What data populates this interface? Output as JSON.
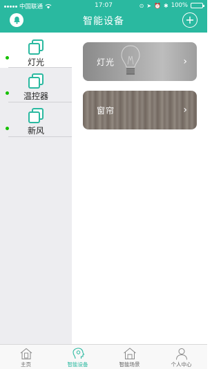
{
  "status_bar": {
    "carrier": "中国联通",
    "time": "17:07",
    "battery": "100%"
  },
  "header": {
    "title": "智能设备"
  },
  "sidebar": {
    "items": [
      {
        "label": "灯光"
      },
      {
        "label": "温控器"
      },
      {
        "label": "新风"
      }
    ]
  },
  "cards": [
    {
      "label": "灯光",
      "chevron": "›"
    },
    {
      "label": "窗帘",
      "chevron": "›"
    }
  ],
  "tabbar": {
    "items": [
      {
        "label": "主页",
        "icon": "home-icon"
      },
      {
        "label": "智能设备",
        "icon": "smart-device-icon"
      },
      {
        "label": "智能场景",
        "icon": "scene-icon"
      },
      {
        "label": "个人中心",
        "icon": "user-icon"
      }
    ]
  },
  "colors": {
    "accent": "#2ab9a0",
    "status_dot": "#16c000"
  }
}
